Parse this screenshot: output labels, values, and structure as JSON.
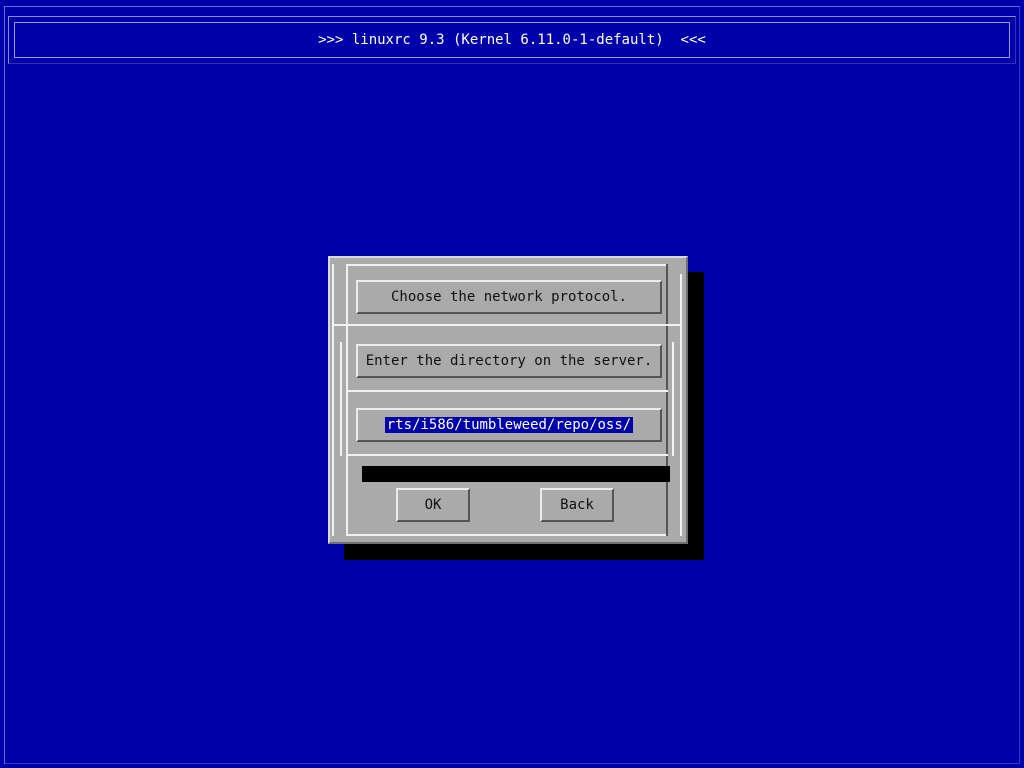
{
  "window": {
    "title": ">>> linuxrc 9.3 (Kernel 6.11.0-1-default)  <<<"
  },
  "dialog": {
    "protocol_label": "Choose the network protocol.",
    "directory_label": "Enter the directory on the server.",
    "directory_value": "rts/i586/tumbleweed/repo/oss/",
    "ok_label": "OK",
    "back_label": "Back"
  },
  "colors": {
    "background": "#0000a8",
    "dialog": "#aaaaaa",
    "selection": "#0000a8",
    "shadow": "#000000"
  }
}
